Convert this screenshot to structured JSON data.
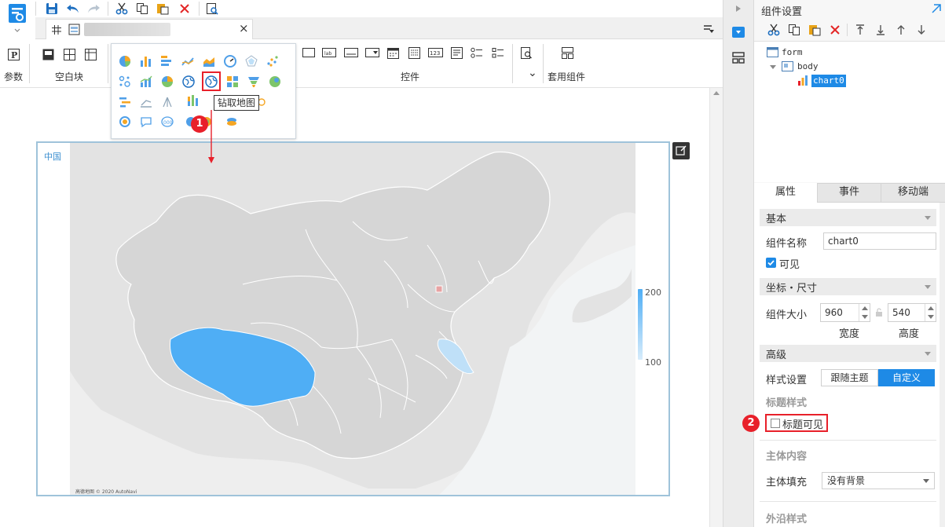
{
  "tab": {
    "title": "",
    "close": "×"
  },
  "ribbon": {
    "param_label": "参数",
    "blank_label": "空白块",
    "controls_label": "控件",
    "template_label": "套用组件",
    "chevron": "⌄"
  },
  "chart_gallery": {
    "tooltip": "钻取地图"
  },
  "canvas": {
    "map_label": "中国",
    "legend_max": "200",
    "legend_min": "100",
    "attribution": "高德地图 © 2020 AutoNavi"
  },
  "markers": {
    "one": "1",
    "two": "2"
  },
  "right_panel": {
    "title": "组件设置",
    "tree": {
      "form": "form",
      "body": "body",
      "chart": "chart0"
    },
    "tabs": [
      "属性",
      "事件",
      "移动端"
    ],
    "sections": {
      "basic": "基本",
      "coords": "坐标・尺寸",
      "advanced": "高级",
      "title_style": "标题样式",
      "main_content": "主体内容",
      "outer_style": "外沿样式"
    },
    "fields": {
      "name_label": "组件名称",
      "name_value": "chart0",
      "visible_label": "可见",
      "size_label": "组件大小",
      "width_value": "960",
      "height_value": "540",
      "width_label": "宽度",
      "height_label": "高度",
      "style_label": "样式设置",
      "style_follow": "跟随主题",
      "style_custom": "自定义",
      "title_visible_label": "标题可见",
      "fill_label": "主体填充",
      "fill_value": "没有背景"
    }
  },
  "colors": {
    "accent": "#1e8ae6",
    "highlight": "#4faef5",
    "light_highlight": "#bfe0f8",
    "province": "#dcdcdc",
    "marker": "#e8202a"
  }
}
